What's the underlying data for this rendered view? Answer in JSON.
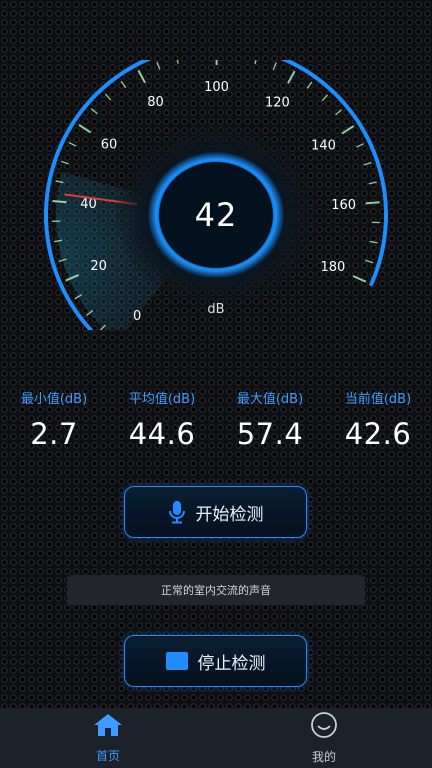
{
  "gauge": {
    "current_value": "42",
    "unit": "dB",
    "needle_value": 42,
    "scale_min": 0,
    "scale_max": 180,
    "scale_labels": [
      "0",
      "20",
      "40",
      "60",
      "80",
      "100",
      "120",
      "140",
      "160",
      "180"
    ],
    "colors": {
      "arc": "#1b8fff",
      "needle": "#e03b3b",
      "tick": "#9be6b0",
      "tick_text": "#ffffff"
    }
  },
  "stats": [
    {
      "label": "最小值(dB)",
      "value": "2.7"
    },
    {
      "label": "平均值(dB)",
      "value": "44.6"
    },
    {
      "label": "最大值(dB)",
      "value": "57.4"
    },
    {
      "label": "当前值(dB)",
      "value": "42.6"
    }
  ],
  "buttons": {
    "start_label": "开始检测",
    "start_icon": "microphone-icon",
    "stop_label": "停止检测",
    "stop_icon": "stop-square-icon"
  },
  "status_text": "正常的室内交流的声音",
  "nav": {
    "home_label": "首页",
    "home_icon": "home-icon",
    "me_label": "我的",
    "me_icon": "smiley-face-icon",
    "active_color": "#3f9bff"
  }
}
